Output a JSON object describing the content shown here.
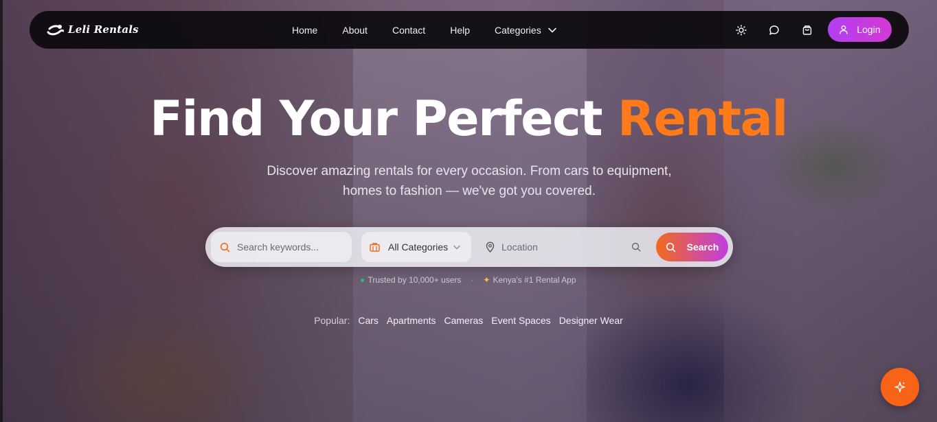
{
  "brand": {
    "name": "Leli Rentals"
  },
  "nav": {
    "links": [
      "Home",
      "About",
      "Contact",
      "Help"
    ],
    "categories_label": "Categories",
    "login_label": "Login"
  },
  "hero": {
    "title_main": "Find Your Perfect ",
    "title_accent": "Rental",
    "subtitle_line1": "Discover amazing rentals for every occasion. From cars to equipment,",
    "subtitle_line2": "homes to fashion — we've got you covered."
  },
  "search": {
    "keywords_placeholder": "Search keywords...",
    "category_value": "All Categories",
    "location_placeholder": "Location",
    "button_label": "Search"
  },
  "trust": {
    "users": "Trusted by 10,000+ users",
    "badge": "Kenya's #1 Rental App"
  },
  "popular": {
    "label": "Popular:",
    "tags": [
      "Cars",
      "Apartments",
      "Cameras",
      "Event Spaces",
      "Designer Wear"
    ]
  },
  "colors": {
    "accent_orange": "#ff7a1a",
    "login_purple": "#b23ff0",
    "navbar_bg": "#0c0a0e",
    "fab_orange": "#f76418"
  },
  "icons": {
    "theme": "sun-icon",
    "chat": "message-icon",
    "cart": "shopping-bag-icon",
    "user": "user-icon",
    "fab": "sparkles-icon"
  }
}
